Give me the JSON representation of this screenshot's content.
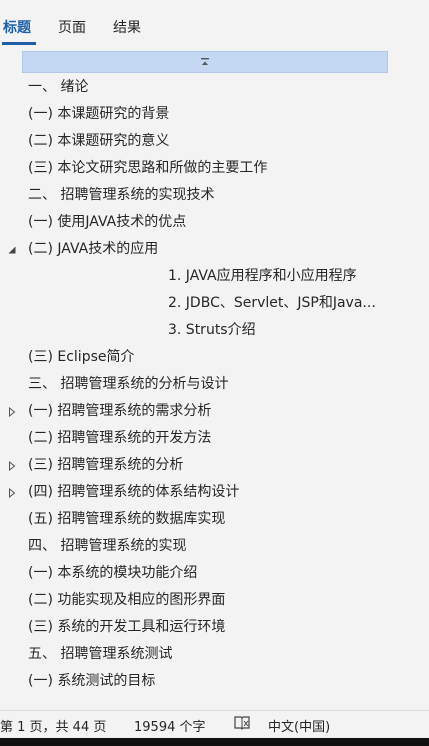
{
  "tabs": [
    {
      "label": "标题",
      "active": true
    },
    {
      "label": "页面",
      "active": false
    },
    {
      "label": "结果",
      "active": false
    }
  ],
  "nav_items": [
    {
      "label": "一、 绪论",
      "level": 1,
      "toggle": "none"
    },
    {
      "label": "(一) 本课题研究的背景",
      "level": 1,
      "toggle": "none"
    },
    {
      "label": "(二) 本课题研究的意义",
      "level": 1,
      "toggle": "none"
    },
    {
      "label": "(三) 本论文研究思路和所做的主要工作",
      "level": 1,
      "toggle": "none"
    },
    {
      "label": "二、 招聘管理系统的实现技术",
      "level": 1,
      "toggle": "none"
    },
    {
      "label": "(一) 使用JAVA技术的优点",
      "level": 1,
      "toggle": "none"
    },
    {
      "label": "(二) JAVA技术的应用",
      "level": 1,
      "toggle": "expanded"
    },
    {
      "label": "1. JAVA应用程序和小应用程序",
      "level": 2,
      "toggle": "none"
    },
    {
      "label": "2. JDBC、Servlet、JSP和Java...",
      "level": 2,
      "toggle": "none"
    },
    {
      "label": "3. Struts介绍",
      "level": 2,
      "toggle": "none"
    },
    {
      "label": "(三) Eclipse简介",
      "level": 1,
      "toggle": "none"
    },
    {
      "label": "三、 招聘管理系统的分析与设计",
      "level": 1,
      "toggle": "none"
    },
    {
      "label": "(一) 招聘管理系统的需求分析",
      "level": 1,
      "toggle": "collapsed"
    },
    {
      "label": "(二) 招聘管理系统的开发方法",
      "level": 1,
      "toggle": "none"
    },
    {
      "label": "(三) 招聘管理系统的分析",
      "level": 1,
      "toggle": "collapsed"
    },
    {
      "label": "(四) 招聘管理系统的体系结构设计",
      "level": 1,
      "toggle": "collapsed"
    },
    {
      "label": "(五) 招聘管理系统的数据库实现",
      "level": 1,
      "toggle": "none"
    },
    {
      "label": "四、 招聘管理系统的实现",
      "level": 1,
      "toggle": "none"
    },
    {
      "label": "(一) 本系统的模块功能介绍",
      "level": 1,
      "toggle": "none"
    },
    {
      "label": "(二) 功能实现及相应的图形界面",
      "level": 1,
      "toggle": "none"
    },
    {
      "label": "(三) 系统的开发工具和运行环境",
      "level": 1,
      "toggle": "none"
    },
    {
      "label": "五、 招聘管理系统测试",
      "level": 1,
      "toggle": "none"
    },
    {
      "label": "(一) 系统测试的目标",
      "level": 1,
      "toggle": "none"
    }
  ],
  "statusbar": {
    "page_info": "第 1 页，共 44 页",
    "word_count": "19594 个字",
    "language": "中文(中国)"
  },
  "colors": {
    "accent": "#1f5fa8",
    "selection_bar": "#c5d8f3"
  }
}
